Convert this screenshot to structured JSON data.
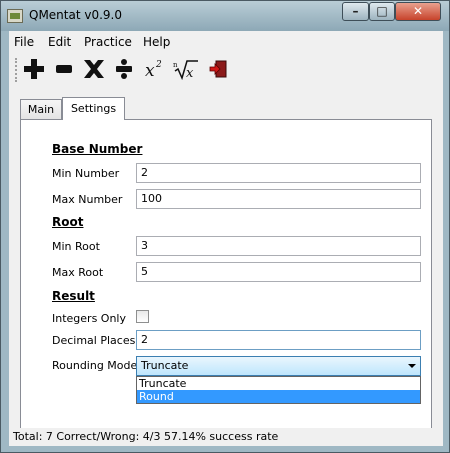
{
  "window": {
    "title": "QMentat v0.9.0"
  },
  "menu": {
    "items": [
      "File",
      "Edit",
      "Practice",
      "Help"
    ]
  },
  "toolbar": {
    "icons": [
      "add-icon",
      "subtract-icon",
      "multiply-icon",
      "divide-icon",
      "power-icon",
      "root-icon",
      "exit-icon"
    ]
  },
  "tabs": [
    {
      "label": "Main",
      "active": false
    },
    {
      "label": "Settings",
      "active": true
    }
  ],
  "settings": {
    "base_number": {
      "title": "Base Number",
      "min_label": "Min Number",
      "min_value": "2",
      "max_label": "Max Number",
      "max_value": "100"
    },
    "root": {
      "title": "Root",
      "min_label": "Min Root",
      "min_value": "3",
      "max_label": "Max Root",
      "max_value": "5"
    },
    "result": {
      "title": "Result",
      "integers_label": "Integers Only",
      "integers_checked": false,
      "decimal_label": "Decimal Places",
      "decimal_value": "2",
      "rounding_label": "Rounding Mode",
      "rounding_value": "Truncate",
      "rounding_options": [
        "Truncate",
        "Round"
      ],
      "rounding_highlighted": "Round"
    }
  },
  "status": {
    "text": "Total: 7  Correct/Wrong: 4/3  57.14% success rate"
  },
  "colors": {
    "highlight": "#3399ff",
    "close_button": "#c7432b"
  }
}
